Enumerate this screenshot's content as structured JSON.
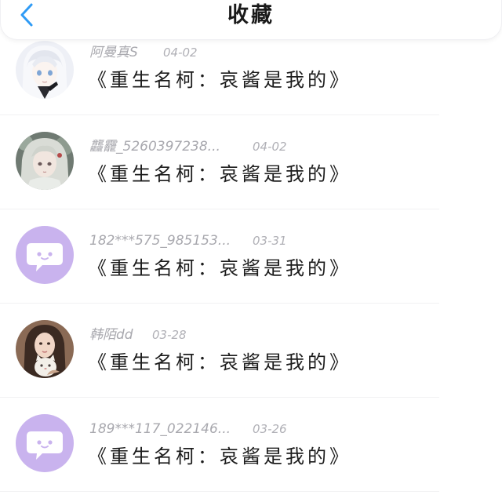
{
  "header": {
    "title": "收藏",
    "back_icon": "chevron-left-icon",
    "accent_color": "#2f9bf5"
  },
  "items": [
    {
      "username": "阿曼真S",
      "date": "04-02",
      "title": "《重生名柯：哀酱是我的》",
      "avatar": "anime-white-hair-girl"
    },
    {
      "username": "龘龗_5260397238...",
      "date": "04-02",
      "title": "《重生名柯：哀酱是我的》",
      "avatar": "anime-silver-hair-character"
    },
    {
      "username": "182***575_985153...",
      "date": "03-31",
      "title": "《重生名柯：哀酱是我的》",
      "avatar": "default-chat-bubble-avatar"
    },
    {
      "username": "韩陌dd",
      "date": "03-28",
      "title": "《重生名柯：哀酱是我的》",
      "avatar": "girl-with-cat-photo"
    },
    {
      "username": "189***117_022146...",
      "date": "03-26",
      "title": "《重生名柯：哀酱是我的》",
      "avatar": "default-chat-bubble-avatar"
    }
  ],
  "colors": {
    "default_avatar_bg": "#c9b3ee",
    "meta_text": "#a8a8ae",
    "title_text": "#1c1c1c"
  }
}
